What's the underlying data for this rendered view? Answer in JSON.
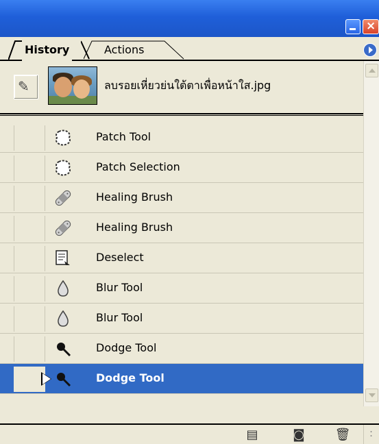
{
  "panel": {
    "tabs": [
      {
        "label": "History",
        "active": true
      },
      {
        "label": "Actions",
        "active": false
      }
    ]
  },
  "snapshot": {
    "label": "ลบรอยเหี่ยวย่นใต้ตาเพื่อหน้าใส.jpg",
    "icon": "history-brush-icon"
  },
  "history": [
    {
      "label": "Patch Tool",
      "icon": "patch-tool-icon"
    },
    {
      "label": "Patch Selection",
      "icon": "patch-tool-icon"
    },
    {
      "label": "Healing Brush",
      "icon": "healing-brush-icon"
    },
    {
      "label": "Healing Brush",
      "icon": "healing-brush-icon"
    },
    {
      "label": "Deselect",
      "icon": "deselect-icon"
    },
    {
      "label": "Blur Tool",
      "icon": "blur-tool-icon"
    },
    {
      "label": "Blur Tool",
      "icon": "blur-tool-icon"
    },
    {
      "label": "Dodge Tool",
      "icon": "dodge-tool-icon"
    },
    {
      "label": "Dodge Tool",
      "icon": "dodge-tool-icon",
      "selected": true
    }
  ],
  "toolbar": {
    "icons": [
      "new-document-from-state-icon",
      "new-snapshot-icon",
      "delete-state-icon"
    ]
  },
  "colors": {
    "titlebar": "#1f5fd9",
    "selection": "#316ac5",
    "panel_bg": "#ece9d8"
  }
}
